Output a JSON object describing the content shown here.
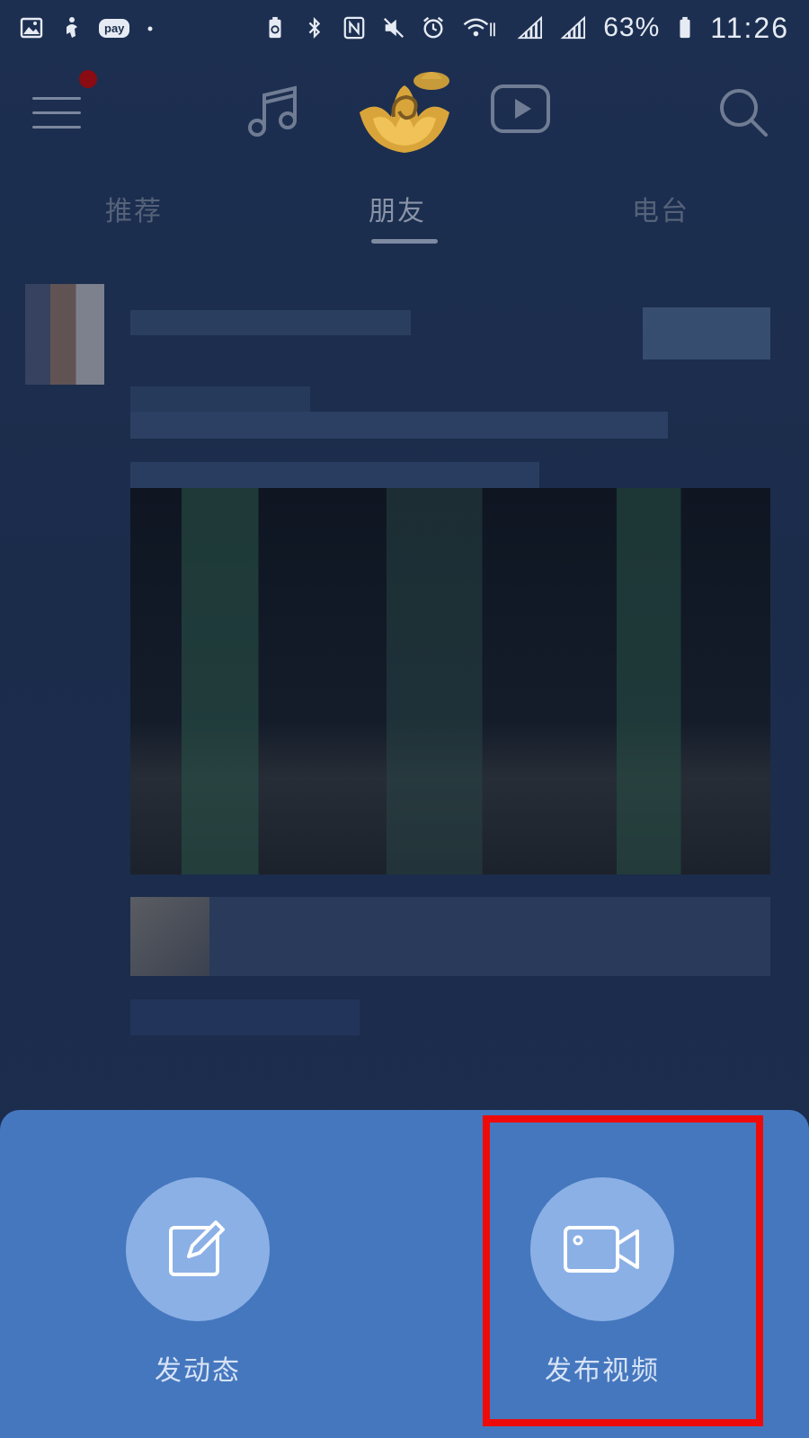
{
  "status_bar": {
    "battery": "63%",
    "time": "11:26",
    "pay_badge": "pay",
    "icons": [
      "gallery-icon",
      "figure-icon",
      "pay-badge",
      "dot",
      "battery-saver-icon",
      "bluetooth-icon",
      "nfc-icon",
      "mute-icon",
      "alarm-icon",
      "wifi-icon",
      "signal-icon",
      "signal-4g-icon",
      "battery-icon"
    ]
  },
  "header": {
    "icons": [
      "menu-icon",
      "music-note-icon",
      "lotus-logo",
      "video-play-icon",
      "search-icon"
    ],
    "notification_dot_color": "#8a0b12"
  },
  "tabs": [
    {
      "label": "推荐",
      "active": false
    },
    {
      "label": "朋友",
      "active": true
    },
    {
      "label": "电台",
      "active": false
    }
  ],
  "sheet": {
    "actions": [
      {
        "label": "发动态",
        "icon": "edit-icon"
      },
      {
        "label": "发布视频",
        "icon": "video-camera-icon"
      }
    ]
  },
  "colors": {
    "sheet": "#4577be",
    "circle": "#8bb0e6",
    "highlight": "#ef0a0a"
  }
}
